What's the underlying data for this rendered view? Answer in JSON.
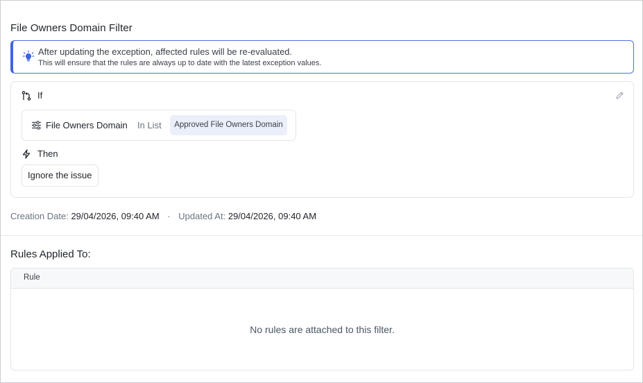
{
  "filter": {
    "title": "File Owners Domain Filter"
  },
  "info": {
    "icon": "lightbulb-icon",
    "message": "After updating the exception, affected rules will be re-evaluated.",
    "detail": "This will ensure that the rules are always up to date with the latest exception values.",
    "accent_color": "#3f63e0"
  },
  "if_section": {
    "label": "If",
    "icon": "branch-icon",
    "condition": {
      "icon": "sliders-icon",
      "field": "File Owners Domain",
      "operator": "In List",
      "value": "Approved File Owners Domain"
    }
  },
  "then_section": {
    "label": "Then",
    "icon": "lightning-icon",
    "action": "Ignore the issue"
  },
  "meta": {
    "creation_label": "Creation Date:",
    "creation_value": "29/04/2026, 09:40 AM",
    "separator": "·",
    "updated_label": "Updated At:",
    "updated_value": "29/04/2026, 09:40 AM"
  },
  "rules": {
    "title": "Rules Applied To:",
    "columns": [
      "Rule"
    ],
    "empty_message": "No rules are attached to this filter."
  }
}
